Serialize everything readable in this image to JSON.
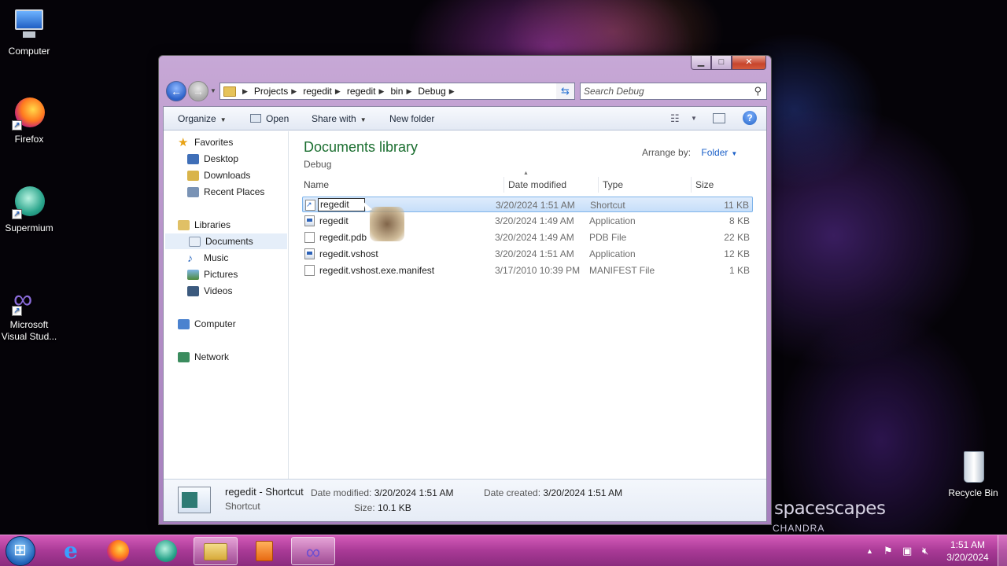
{
  "desktop": {
    "icons": [
      {
        "label": "Computer"
      },
      {
        "label": "Firefox"
      },
      {
        "label": "Supermium"
      },
      {
        "label": "Microsoft Visual Stud..."
      },
      {
        "label": "Recycle Bin"
      }
    ],
    "wallpaper_text": "spacescapes",
    "wallpaper_subtext": "CHANDRA"
  },
  "window": {
    "breadcrumbs": [
      "Projects",
      "regedit",
      "regedit",
      "bin",
      "Debug"
    ],
    "search_placeholder": "Search Debug",
    "toolbar": {
      "organize": "Organize",
      "open": "Open",
      "share_with": "Share with",
      "new_folder": "New folder"
    },
    "nav": {
      "favorites": "Favorites",
      "desktop": "Desktop",
      "downloads": "Downloads",
      "recent_places": "Recent Places",
      "libraries": "Libraries",
      "documents": "Documents",
      "music": "Music",
      "pictures": "Pictures",
      "videos": "Videos",
      "computer": "Computer",
      "network": "Network"
    },
    "library_title": "Documents library",
    "library_subtitle": "Debug",
    "arrange_label": "Arrange by:",
    "arrange_value": "Folder",
    "columns": {
      "name": "Name",
      "date": "Date modified",
      "type": "Type",
      "size": "Size"
    },
    "rows": [
      {
        "name": "regedit",
        "date": "3/20/2024 1:51 AM",
        "type": "Shortcut",
        "size": "11 KB"
      },
      {
        "name": "regedit",
        "date": "3/20/2024 1:49 AM",
        "type": "Application",
        "size": "8 KB"
      },
      {
        "name": "regedit.pdb",
        "date": "3/20/2024 1:49 AM",
        "type": "PDB File",
        "size": "22 KB"
      },
      {
        "name": "regedit.vshost",
        "date": "3/20/2024 1:51 AM",
        "type": "Application",
        "size": "12 KB"
      },
      {
        "name": "regedit.vshost.exe.manifest",
        "date": "3/17/2010 10:39 PM",
        "type": "MANIFEST File",
        "size": "1 KB"
      }
    ],
    "rename_value": "regedit",
    "details": {
      "name": "regedit - Shortcut",
      "kind": "Shortcut",
      "date_modified_label": "Date modified:",
      "date_modified": "3/20/2024 1:51 AM",
      "date_created_label": "Date created:",
      "date_created": "3/20/2024 1:51 AM",
      "size_label": "Size:",
      "size": "10.1 KB"
    }
  },
  "taskbar": {
    "clock_time": "1:51 AM",
    "clock_date": "3/20/2024"
  }
}
